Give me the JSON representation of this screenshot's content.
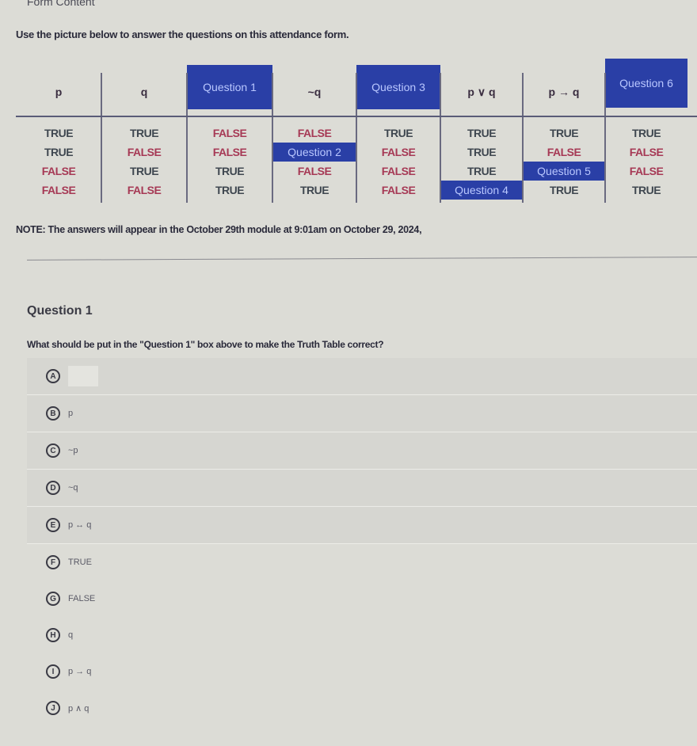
{
  "header": {
    "label": "Form Content"
  },
  "intro": "Use the picture below to answer the questions on this attendance form.",
  "truth_table": {
    "columns": [
      {
        "header": "p",
        "header_is_question": false,
        "cells": [
          {
            "v": "TRUE"
          },
          {
            "v": "TRUE"
          },
          {
            "v": "FALSE"
          },
          {
            "v": "FALSE"
          }
        ]
      },
      {
        "header": "q",
        "header_is_question": false,
        "cells": [
          {
            "v": "TRUE"
          },
          {
            "v": "FALSE"
          },
          {
            "v": "TRUE"
          },
          {
            "v": "FALSE"
          }
        ]
      },
      {
        "header": "Question 1",
        "header_is_question": true,
        "cells": [
          {
            "v": "FALSE"
          },
          {
            "v": "FALSE"
          },
          {
            "v": "TRUE"
          },
          {
            "v": "TRUE"
          }
        ]
      },
      {
        "header": "~q",
        "header_is_question": false,
        "cells": [
          {
            "v": "FALSE"
          },
          {
            "v": "Question 2",
            "q": true
          },
          {
            "v": "FALSE"
          },
          {
            "v": "TRUE"
          }
        ]
      },
      {
        "header": "Question 3",
        "header_is_question": true,
        "cells": [
          {
            "v": "TRUE"
          },
          {
            "v": "FALSE"
          },
          {
            "v": "FALSE"
          },
          {
            "v": "FALSE"
          }
        ]
      },
      {
        "header": "p ∨ q",
        "header_is_question": false,
        "cells": [
          {
            "v": "TRUE"
          },
          {
            "v": "TRUE"
          },
          {
            "v": "TRUE"
          },
          {
            "v": "Question 4",
            "q": true
          }
        ]
      },
      {
        "header": "p → q",
        "header_is_question": false,
        "cells": [
          {
            "v": "TRUE"
          },
          {
            "v": "FALSE"
          },
          {
            "v": "Question 5",
            "q": true
          },
          {
            "v": "TRUE"
          }
        ]
      },
      {
        "header": "Question 6",
        "header_is_question": true,
        "cells": [
          {
            "v": "TRUE"
          },
          {
            "v": "FALSE"
          },
          {
            "v": "FALSE"
          },
          {
            "v": "TRUE"
          }
        ]
      }
    ]
  },
  "note": "NOTE: The answers will appear in the October 29th module at 9:01am on October 29, 2024,",
  "question": {
    "title": "Question 1",
    "text": "What should be put in the \"Question 1\" box above to make the Truth Table correct?",
    "options": [
      {
        "letter": "A",
        "text": ""
      },
      {
        "letter": "B",
        "text": "p"
      },
      {
        "letter": "C",
        "text": "~p"
      },
      {
        "letter": "D",
        "text": "~q"
      },
      {
        "letter": "E",
        "text": "p ↔ q"
      },
      {
        "letter": "F",
        "text": "TRUE"
      },
      {
        "letter": "G",
        "text": "FALSE"
      },
      {
        "letter": "H",
        "text": "q"
      },
      {
        "letter": "I",
        "text": "p → q"
      },
      {
        "letter": "J",
        "text": "p ∧ q"
      }
    ]
  }
}
